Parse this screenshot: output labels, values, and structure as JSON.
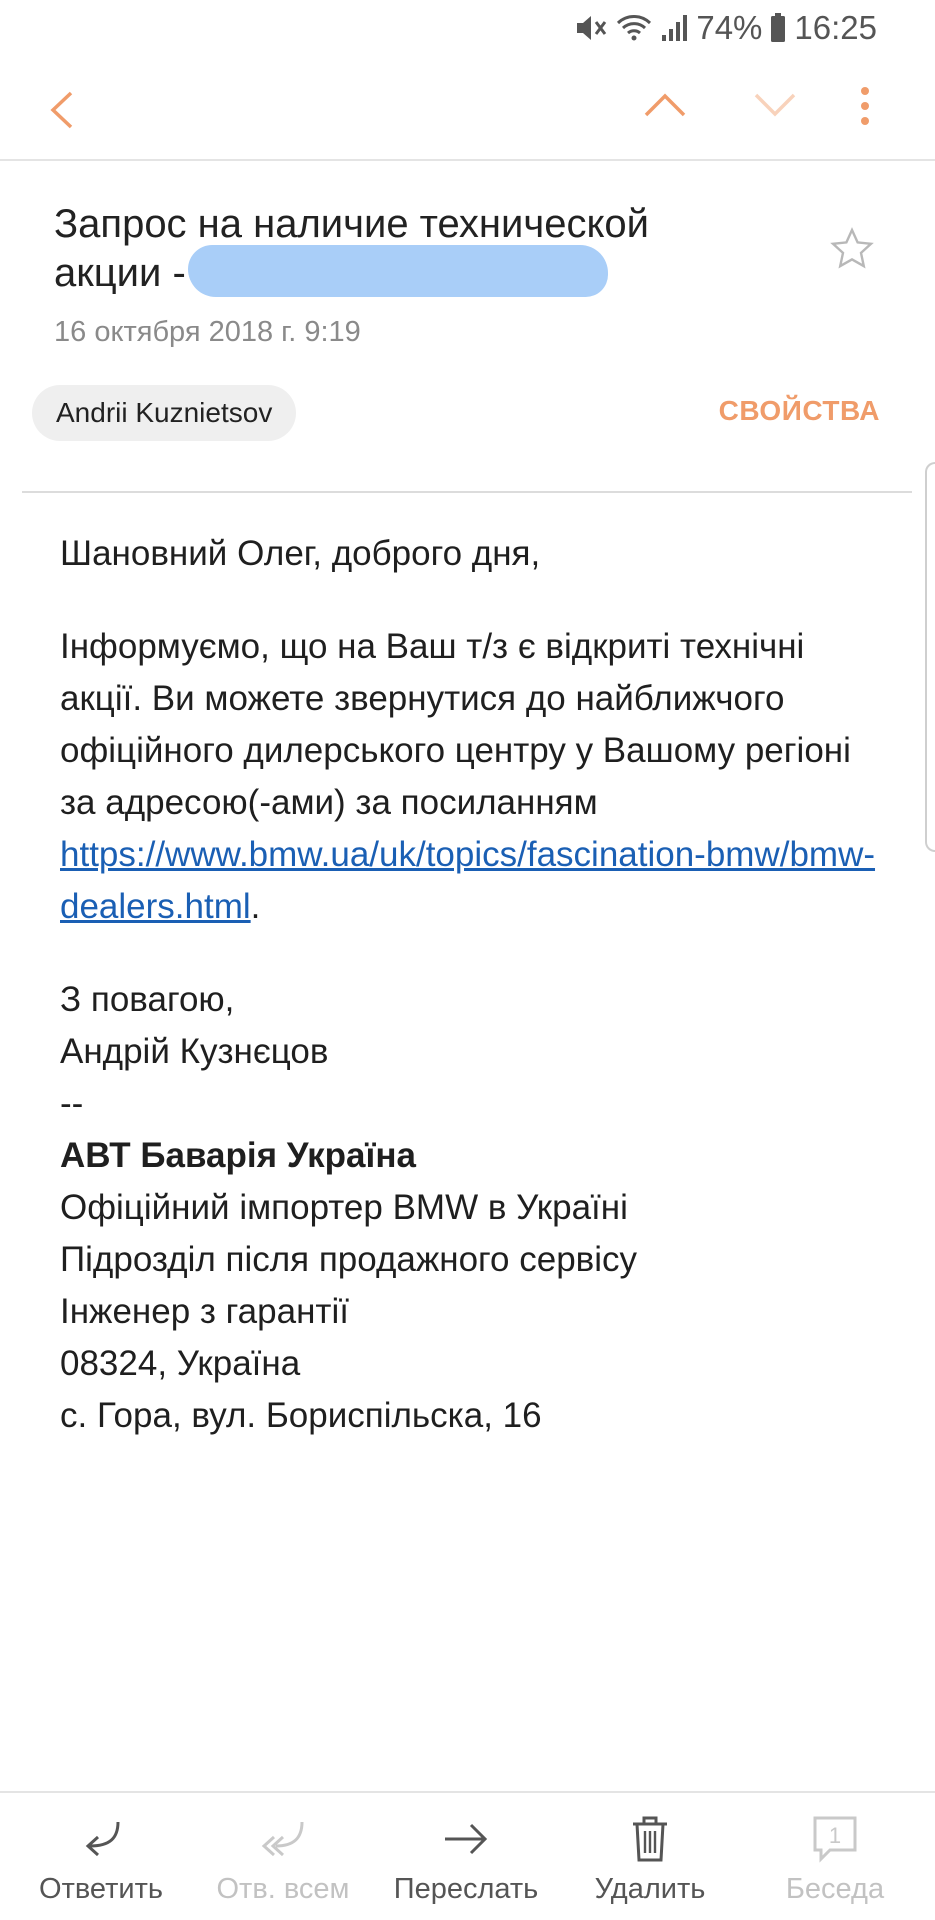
{
  "status_bar": {
    "battery": "74%",
    "time": "16:25",
    "icons": [
      "mute-icon",
      "wifi-icon",
      "signal-icon",
      "battery-icon"
    ]
  },
  "toolbar": {
    "icons": [
      "back-icon",
      "chevron-up-icon",
      "chevron-down-icon",
      "more-vertical-icon"
    ],
    "accent_color": "#f09c6a"
  },
  "email": {
    "subject": "Запрос на наличие технической акции -",
    "date": "16 октября 2018 г.  9:19",
    "sender": "Andrii Kuznietsov",
    "properties_label": "СВОЙСТВА",
    "greeting": "Шановний Олег, доброго дня,",
    "paragraph": "Інформуємо, що на Ваш т/з є відкриті технічні акції. Ви можете звернутися до найближчого офіційного дилерського центру у Вашому регіоні за адресою(-ами) за посиланням",
    "link": "https://www.bmw.ua/uk/topics/fascination-bmw/bmw-dealers.html",
    "link_suffix": ".",
    "signature": {
      "closing": "З повагою,",
      "name": "Андрій Кузнєцов",
      "separator": "--",
      "company": "АВТ Баварія Україна",
      "line1": "Офіційний імпортер BMW в Україні",
      "line2": "Підрозділ після продажного сервісу",
      "line3": "Інженер з гарантії",
      "line4": "08324, Україна",
      "line5": "с. Гора, вул. Бориспільска, 16"
    }
  },
  "bottom_bar": {
    "reply": "Ответить",
    "reply_all": "Отв. всем",
    "forward": "Переслать",
    "delete": "Удалить",
    "conversation": "Беседа",
    "conversation_count": "1"
  }
}
